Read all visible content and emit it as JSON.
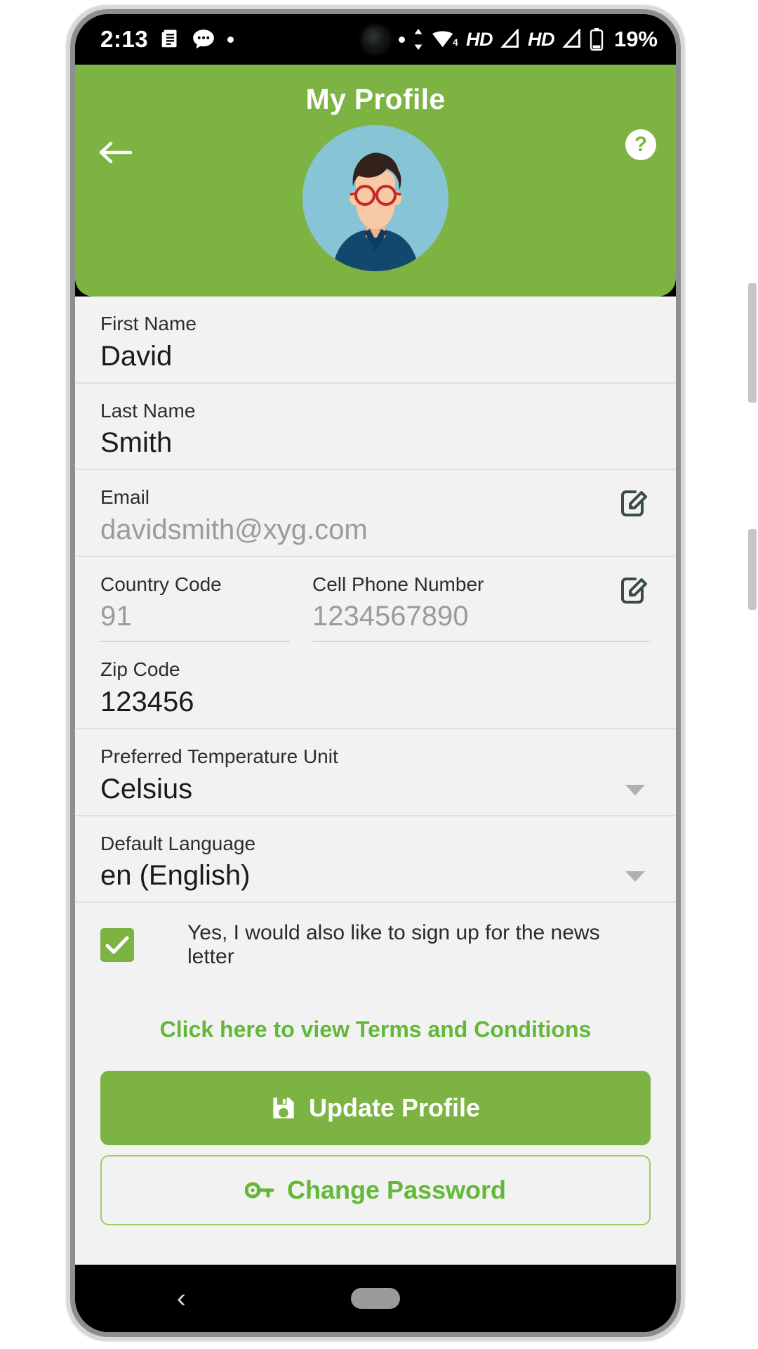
{
  "status_bar": {
    "time": "2:13",
    "icons_left": [
      "document-icon",
      "message-icon",
      "dot-icon"
    ],
    "icons_right": [
      "dot-icon",
      "data-transfer-icon",
      "wifi-icon",
      "hd-badge-1",
      "signal-icon-1",
      "hd-badge-2",
      "signal-icon-2",
      "battery-icon"
    ],
    "wifi_badge": "4",
    "hd_label_1": "HD",
    "hd_label_2": "HD",
    "battery_percent": "19%"
  },
  "header": {
    "title": "My Profile",
    "back_icon": "arrow-left-icon",
    "help_icon": "question-mark-icon",
    "help_label": "?",
    "avatar_alt": "user-avatar"
  },
  "form": {
    "first_name": {
      "label": "First Name",
      "value": "David"
    },
    "last_name": {
      "label": "Last Name",
      "value": "Smith"
    },
    "email": {
      "label": "Email",
      "value": "davidsmith@xyg.com",
      "edit_icon": "edit-pencil-icon"
    },
    "country_code": {
      "label": "Country Code",
      "value": "91"
    },
    "cell_phone": {
      "label": "Cell Phone Number",
      "value": "1234567890",
      "edit_icon": "edit-pencil-icon"
    },
    "zip_code": {
      "label": "Zip Code",
      "value": "123456"
    },
    "temperature_unit": {
      "label": "Preferred Temperature Unit",
      "value": "Celsius"
    },
    "default_language": {
      "label": "Default Language",
      "value": "en (English)"
    },
    "newsletter": {
      "label": "Yes, I would also like to sign up for the news letter",
      "checked": true,
      "check_glyph": "✓"
    },
    "terms_link": "Click here to view Terms and Conditions"
  },
  "actions": {
    "update_profile": {
      "label": "Update Profile",
      "icon": "save-disk-icon"
    },
    "change_password": {
      "label": "Change Password",
      "icon": "key-icon"
    }
  },
  "nav_bar": {
    "back_glyph": "‹",
    "home_pill": "home-pill"
  },
  "colors": {
    "brand_green": "#7cb342",
    "link_green": "#63b838",
    "content_bg": "#f2f2f2",
    "avatar_bg": "#87c5d6",
    "muted_text": "#9b9b9b"
  }
}
